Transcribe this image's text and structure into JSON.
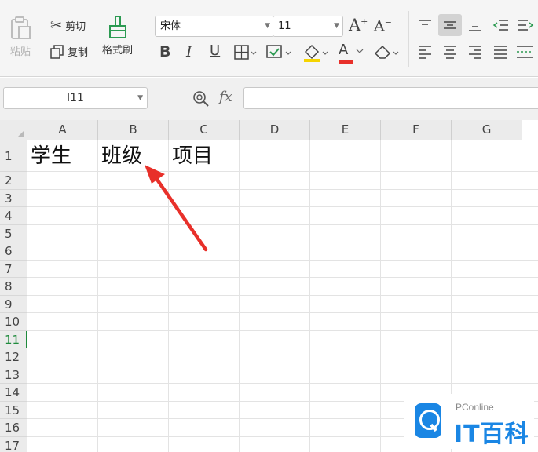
{
  "ribbon": {
    "paste_label": "粘贴",
    "cut_label": "剪切",
    "copy_label": "复制",
    "format_painter_label": "格式刷",
    "font_name": "宋体",
    "font_size": "11",
    "increase_font_label": "A",
    "decrease_font_label": "A",
    "bold_label": "B",
    "italic_label": "I",
    "underline_label": "U",
    "font_color_label": "A"
  },
  "formula_bar": {
    "name_box": "I11",
    "fx_label": "fx",
    "formula": ""
  },
  "sheet": {
    "columns": [
      "A",
      "B",
      "C",
      "D",
      "E",
      "F",
      "G"
    ],
    "rows": [
      "1",
      "2",
      "3",
      "4",
      "5",
      "6",
      "7",
      "8",
      "9",
      "10",
      "11",
      "12",
      "13",
      "14",
      "15",
      "16",
      "17"
    ],
    "active_row": "11",
    "cells": {
      "A1": "学生",
      "B1": "班级",
      "C1": "项目"
    }
  },
  "watermark": {
    "brand": "PConline",
    "name": "IT百科"
  },
  "colors": {
    "accent_green": "#1e8a3c",
    "arrow_red": "#e8302a",
    "logo_blue": "#1a86e4"
  }
}
